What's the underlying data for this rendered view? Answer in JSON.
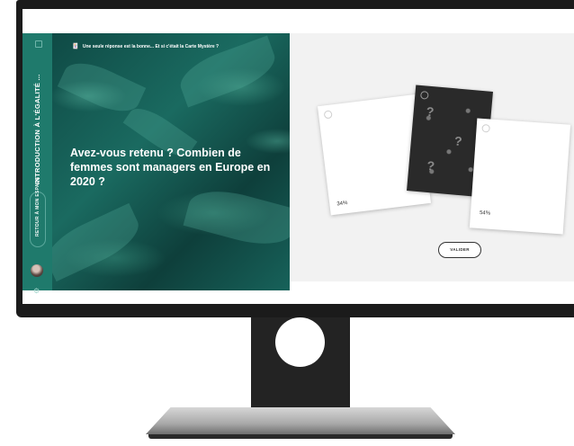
{
  "sidebar": {
    "course_title": "INTRODUCTION À L'ÉGALITÉ ...",
    "back_label": "RETOUR À MON ESPACE"
  },
  "hero": {
    "header_text": "Une seule réponse est la bonne... Et si c'était la Carte Mystère ?",
    "question": "Avez-vous retenu ? Combien de femmes sont managers en Europe en 2020 ?"
  },
  "cards": [
    {
      "label": "34%"
    },
    {
      "label": "?"
    },
    {
      "label": "54%"
    }
  ],
  "actions": {
    "submit_label": "VALIDER"
  },
  "colors": {
    "sidebar": "#1f7a6c",
    "hero_dark": "#0f4a45",
    "stage_bg": "#f2f2f2"
  }
}
